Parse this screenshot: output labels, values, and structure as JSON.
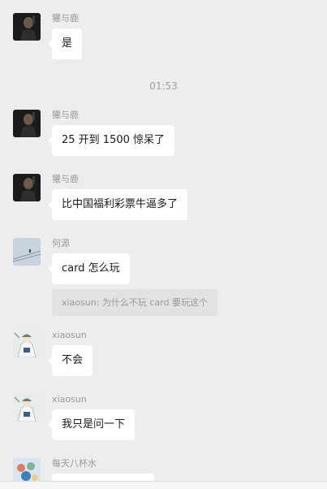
{
  "timestamp": "01:53",
  "messages": [
    {
      "sender": "獾与鹿",
      "avatar": "dark-portrait-avatar",
      "text": "是"
    },
    {
      "sender": "獾与鹿",
      "avatar": "dark-portrait-avatar",
      "text": "25 开到 1500  惊呆了"
    },
    {
      "sender": "獾与鹿",
      "avatar": "dark-portrait-avatar",
      "text": "比中国福利彩票牛逼多了"
    },
    {
      "sender": "何源",
      "avatar": "sky-wire-avatar",
      "text": "card 怎么玩",
      "quote": "xiaosun: 为什么不玩 card 要玩这个"
    },
    {
      "sender": "xiaosun",
      "avatar": "anime-character-avatar",
      "text": "不会"
    },
    {
      "sender": "xiaosun",
      "avatar": "anime-character-avatar",
      "text": "我只是问一下"
    },
    {
      "sender": "每天八杯水",
      "avatar": "colorful-pattern-avatar",
      "text": ""
    }
  ]
}
